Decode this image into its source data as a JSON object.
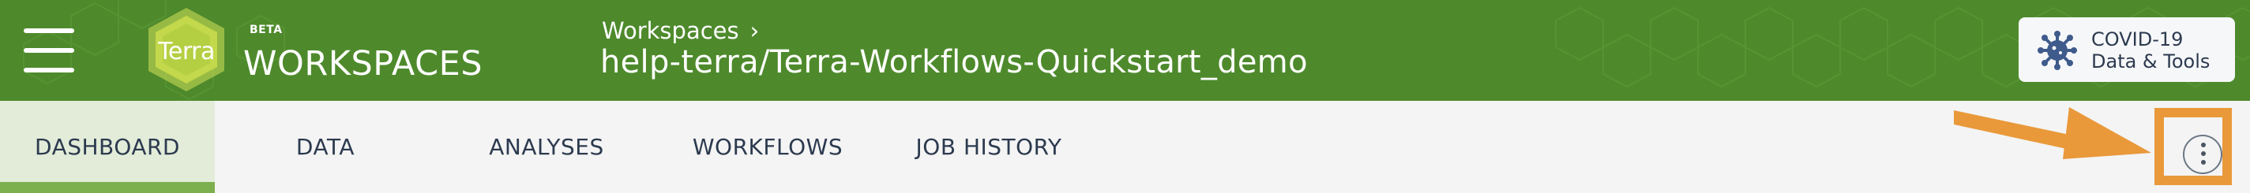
{
  "header": {
    "menu_icon": "hamburger-menu-icon",
    "logo_text": "Terra",
    "beta_label": "BETA",
    "app_title": "WORKSPACES",
    "breadcrumb_label": "Workspaces",
    "breadcrumb_separator": "›",
    "workspace_title": "help-terra/Terra-Workflows-Quickstart_demo",
    "covid_button": {
      "line1": "COVID-19",
      "line2": "Data & Tools",
      "icon": "virus-icon"
    },
    "colors": {
      "header_bg": "#4e8a2c",
      "logo_green": "#c3d84b"
    }
  },
  "tabs": [
    {
      "label": "DASHBOARD",
      "active": true
    },
    {
      "label": "DATA",
      "active": false
    },
    {
      "label": "ANALYSES",
      "active": false
    },
    {
      "label": "WORKFLOWS",
      "active": false
    },
    {
      "label": "JOB HISTORY",
      "active": false
    }
  ],
  "actions": {
    "more_icon": "vertical-dots-icon",
    "highlight_color": "#e9993a",
    "tab_active_color": "#7cb04e"
  }
}
